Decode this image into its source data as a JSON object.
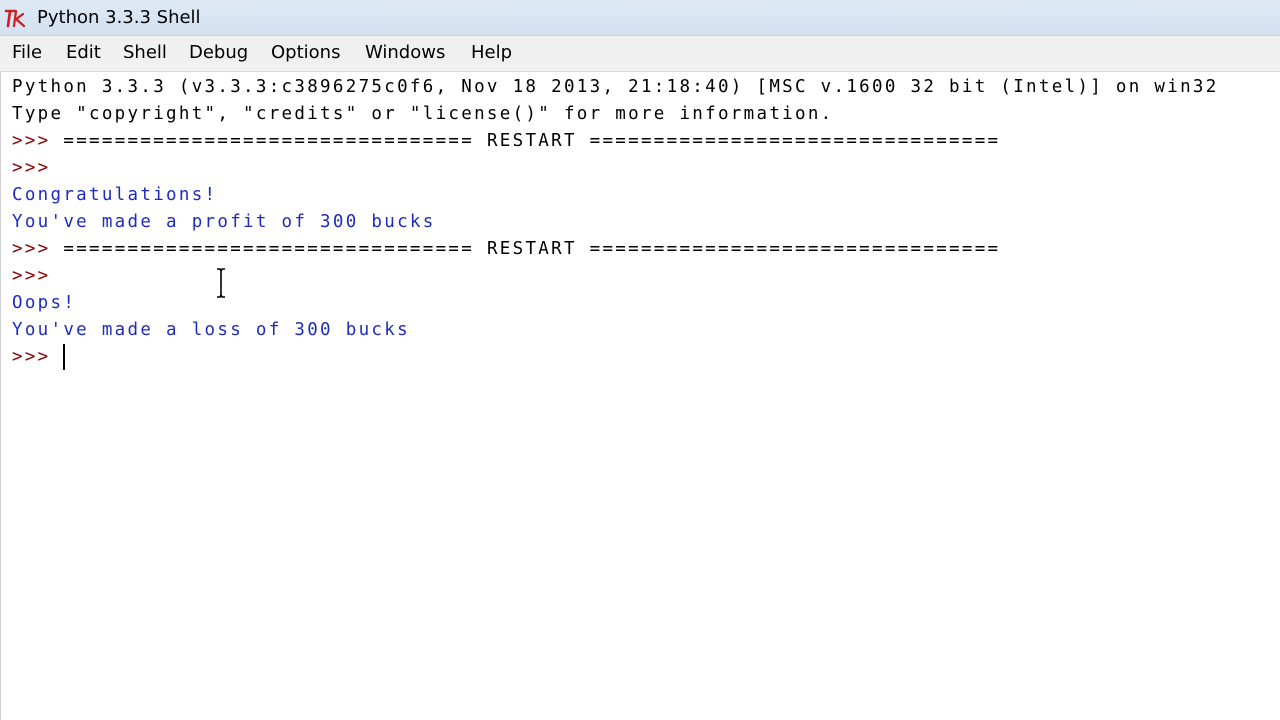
{
  "window": {
    "title": "Python 3.3.3 Shell",
    "icon": "tk-feather-icon"
  },
  "menu": {
    "items": [
      "File",
      "Edit",
      "Shell",
      "Debug",
      "Options",
      "Windows",
      "Help"
    ]
  },
  "shell": {
    "lines": [
      "Python 3.3.3 (v3.3.3:c3896275c0f6, Nov 18 2013, 21:18:40) [MSC v.1600 32 bit (Intel)] on win32",
      "Type \"copyright\", \"credits\" or \"license()\" for more information.",
      "================================ RESTART ================================",
      "",
      "Congratulations!",
      "You've made a profit of 300 bucks",
      "================================ RESTART ================================",
      "",
      "Oops!",
      "You've made a loss of 300 bucks",
      ""
    ],
    "prompt": ">>>"
  },
  "colors": {
    "prompt": "#8b0000",
    "output": "#1f2bbf",
    "text": "#000000"
  }
}
